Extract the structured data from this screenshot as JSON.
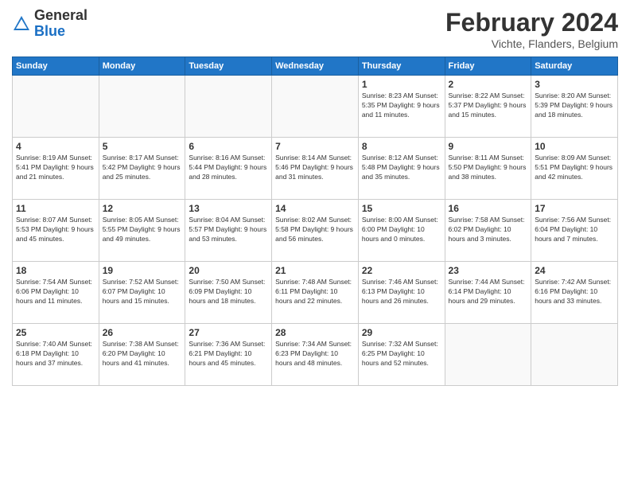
{
  "header": {
    "logo_general": "General",
    "logo_blue": "Blue",
    "month_title": "February 2024",
    "location": "Vichte, Flanders, Belgium"
  },
  "days_of_week": [
    "Sunday",
    "Monday",
    "Tuesday",
    "Wednesday",
    "Thursday",
    "Friday",
    "Saturday"
  ],
  "weeks": [
    [
      {
        "day": "",
        "info": ""
      },
      {
        "day": "",
        "info": ""
      },
      {
        "day": "",
        "info": ""
      },
      {
        "day": "",
        "info": ""
      },
      {
        "day": "1",
        "info": "Sunrise: 8:23 AM\nSunset: 5:35 PM\nDaylight: 9 hours\nand 11 minutes."
      },
      {
        "day": "2",
        "info": "Sunrise: 8:22 AM\nSunset: 5:37 PM\nDaylight: 9 hours\nand 15 minutes."
      },
      {
        "day": "3",
        "info": "Sunrise: 8:20 AM\nSunset: 5:39 PM\nDaylight: 9 hours\nand 18 minutes."
      }
    ],
    [
      {
        "day": "4",
        "info": "Sunrise: 8:19 AM\nSunset: 5:41 PM\nDaylight: 9 hours\nand 21 minutes."
      },
      {
        "day": "5",
        "info": "Sunrise: 8:17 AM\nSunset: 5:42 PM\nDaylight: 9 hours\nand 25 minutes."
      },
      {
        "day": "6",
        "info": "Sunrise: 8:16 AM\nSunset: 5:44 PM\nDaylight: 9 hours\nand 28 minutes."
      },
      {
        "day": "7",
        "info": "Sunrise: 8:14 AM\nSunset: 5:46 PM\nDaylight: 9 hours\nand 31 minutes."
      },
      {
        "day": "8",
        "info": "Sunrise: 8:12 AM\nSunset: 5:48 PM\nDaylight: 9 hours\nand 35 minutes."
      },
      {
        "day": "9",
        "info": "Sunrise: 8:11 AM\nSunset: 5:50 PM\nDaylight: 9 hours\nand 38 minutes."
      },
      {
        "day": "10",
        "info": "Sunrise: 8:09 AM\nSunset: 5:51 PM\nDaylight: 9 hours\nand 42 minutes."
      }
    ],
    [
      {
        "day": "11",
        "info": "Sunrise: 8:07 AM\nSunset: 5:53 PM\nDaylight: 9 hours\nand 45 minutes."
      },
      {
        "day": "12",
        "info": "Sunrise: 8:05 AM\nSunset: 5:55 PM\nDaylight: 9 hours\nand 49 minutes."
      },
      {
        "day": "13",
        "info": "Sunrise: 8:04 AM\nSunset: 5:57 PM\nDaylight: 9 hours\nand 53 minutes."
      },
      {
        "day": "14",
        "info": "Sunrise: 8:02 AM\nSunset: 5:58 PM\nDaylight: 9 hours\nand 56 minutes."
      },
      {
        "day": "15",
        "info": "Sunrise: 8:00 AM\nSunset: 6:00 PM\nDaylight: 10 hours\nand 0 minutes."
      },
      {
        "day": "16",
        "info": "Sunrise: 7:58 AM\nSunset: 6:02 PM\nDaylight: 10 hours\nand 3 minutes."
      },
      {
        "day": "17",
        "info": "Sunrise: 7:56 AM\nSunset: 6:04 PM\nDaylight: 10 hours\nand 7 minutes."
      }
    ],
    [
      {
        "day": "18",
        "info": "Sunrise: 7:54 AM\nSunset: 6:06 PM\nDaylight: 10 hours\nand 11 minutes."
      },
      {
        "day": "19",
        "info": "Sunrise: 7:52 AM\nSunset: 6:07 PM\nDaylight: 10 hours\nand 15 minutes."
      },
      {
        "day": "20",
        "info": "Sunrise: 7:50 AM\nSunset: 6:09 PM\nDaylight: 10 hours\nand 18 minutes."
      },
      {
        "day": "21",
        "info": "Sunrise: 7:48 AM\nSunset: 6:11 PM\nDaylight: 10 hours\nand 22 minutes."
      },
      {
        "day": "22",
        "info": "Sunrise: 7:46 AM\nSunset: 6:13 PM\nDaylight: 10 hours\nand 26 minutes."
      },
      {
        "day": "23",
        "info": "Sunrise: 7:44 AM\nSunset: 6:14 PM\nDaylight: 10 hours\nand 29 minutes."
      },
      {
        "day": "24",
        "info": "Sunrise: 7:42 AM\nSunset: 6:16 PM\nDaylight: 10 hours\nand 33 minutes."
      }
    ],
    [
      {
        "day": "25",
        "info": "Sunrise: 7:40 AM\nSunset: 6:18 PM\nDaylight: 10 hours\nand 37 minutes."
      },
      {
        "day": "26",
        "info": "Sunrise: 7:38 AM\nSunset: 6:20 PM\nDaylight: 10 hours\nand 41 minutes."
      },
      {
        "day": "27",
        "info": "Sunrise: 7:36 AM\nSunset: 6:21 PM\nDaylight: 10 hours\nand 45 minutes."
      },
      {
        "day": "28",
        "info": "Sunrise: 7:34 AM\nSunset: 6:23 PM\nDaylight: 10 hours\nand 48 minutes."
      },
      {
        "day": "29",
        "info": "Sunrise: 7:32 AM\nSunset: 6:25 PM\nDaylight: 10 hours\nand 52 minutes."
      },
      {
        "day": "",
        "info": ""
      },
      {
        "day": "",
        "info": ""
      }
    ]
  ]
}
